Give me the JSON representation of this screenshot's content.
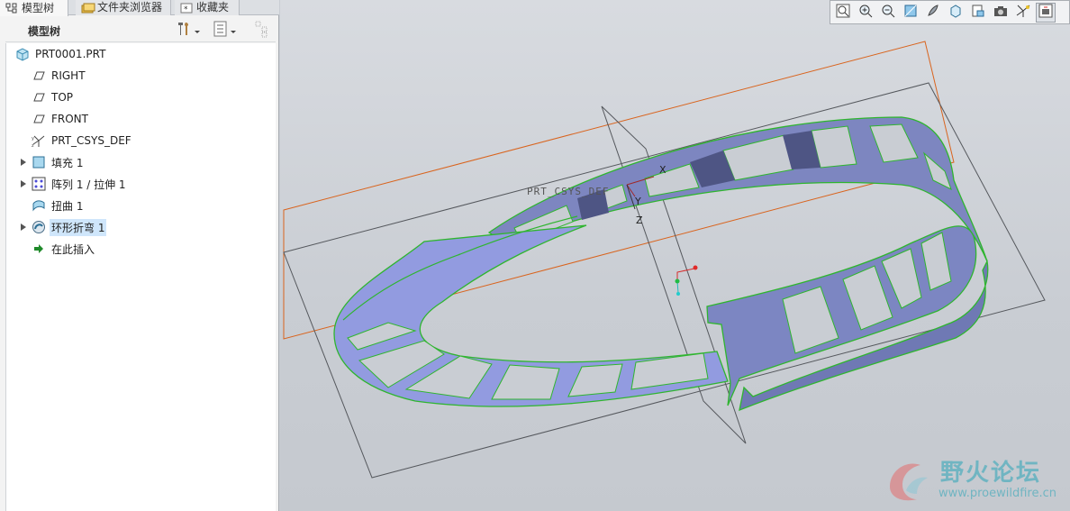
{
  "tabs": [
    {
      "label": "模型树",
      "icon": "tree-icon"
    },
    {
      "label": "文件夹浏览器",
      "icon": "folder-browser-icon"
    },
    {
      "label": "收藏夹",
      "icon": "favorites-icon"
    }
  ],
  "tree_header": {
    "title": "模型树"
  },
  "tree": {
    "root": "PRT0001.PRT",
    "items": [
      {
        "label": "RIGHT",
        "icon": "datum-plane-icon",
        "expandable": false
      },
      {
        "label": "TOP",
        "icon": "datum-plane-icon",
        "expandable": false
      },
      {
        "label": "FRONT",
        "icon": "datum-plane-icon",
        "expandable": false
      },
      {
        "label": "PRT_CSYS_DEF",
        "icon": "csys-icon",
        "expandable": false
      },
      {
        "label": "填充 1",
        "icon": "fill-icon",
        "expandable": true
      },
      {
        "label": "阵列 1 / 拉伸 1",
        "icon": "pattern-icon",
        "expandable": true
      },
      {
        "label": "扭曲 1",
        "icon": "warp-icon",
        "expandable": false
      },
      {
        "label": "环形折弯 1",
        "icon": "toroidal-bend-icon",
        "expandable": true,
        "selected": true
      },
      {
        "label": "在此插入",
        "icon": "insert-here-icon",
        "expandable": false
      }
    ]
  },
  "viewport": {
    "csys_label": "PRT_CSYS_DEF",
    "axis_labels": {
      "x": "X",
      "y": "Y",
      "z": "Z"
    }
  },
  "toolbar": [
    "refit-icon",
    "zoom-in-icon",
    "zoom-out-icon",
    "repaint-icon",
    "display-style-icon",
    "saved-views-icon",
    "view-manager-icon",
    "annotation-display-icon",
    "datum-display-icon",
    "spin-center-icon"
  ],
  "watermark": {
    "title": "野火论坛",
    "url": "www.proewildfire.cn"
  },
  "colors": {
    "selection": "#cfe6fb",
    "part_fill": "#8e96d6",
    "part_edge": "#33bb33",
    "datum_orange": "#d9641e"
  }
}
